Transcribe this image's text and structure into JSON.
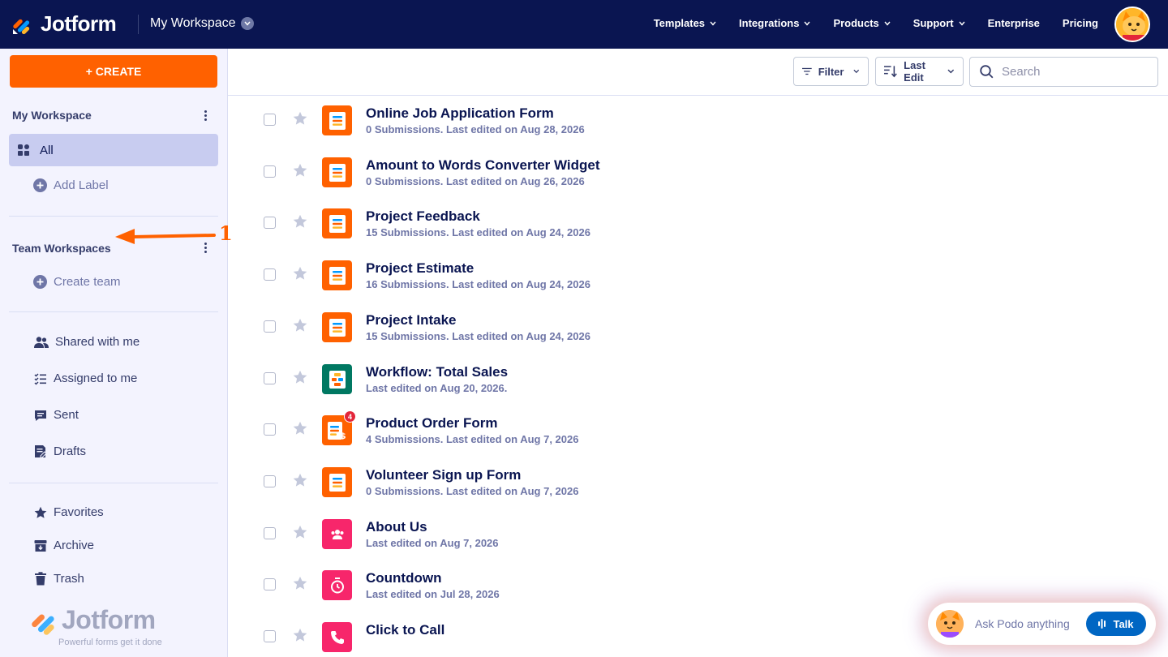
{
  "topnav": {
    "brand": "Jotform",
    "workspace_title": "My Workspace",
    "links": [
      {
        "label": "Templates",
        "has_menu": true
      },
      {
        "label": "Integrations",
        "has_menu": true
      },
      {
        "label": "Products",
        "has_menu": true
      },
      {
        "label": "Support",
        "has_menu": true
      },
      {
        "label": "Enterprise",
        "has_menu": false
      },
      {
        "label": "Pricing",
        "has_menu": false
      }
    ]
  },
  "sidebar": {
    "create_label": "+ CREATE",
    "my_workspace_title": "My Workspace",
    "all_label": "All",
    "add_label": "Add Label",
    "annotation_number": "1",
    "team_title": "Team Workspaces",
    "create_team": "Create team",
    "shared": "Shared with me",
    "assigned": "Assigned to me",
    "sent": "Sent",
    "drafts": "Drafts",
    "favorites": "Favorites",
    "archive": "Archive",
    "trash": "Trash",
    "watermark_brand": "Jotform",
    "watermark_tagline": "Powerful forms get it done"
  },
  "toolbar": {
    "filter_label": "Filter",
    "sort_label": "Last Edit",
    "search_placeholder": "Search"
  },
  "forms": [
    {
      "title": "Online Job Application Form",
      "subtitle": "0 Submissions. Last edited on Aug 28, 2026",
      "icon": "form-icon",
      "color": "#ff6100"
    },
    {
      "title": "Amount to Words Converter Widget",
      "subtitle": "0 Submissions. Last edited on Aug 26, 2026",
      "icon": "form-icon",
      "color": "#ff6100"
    },
    {
      "title": "Project Feedback",
      "subtitle": "15 Submissions. Last edited on Aug 24, 2026",
      "icon": "form-icon",
      "color": "#ff6100"
    },
    {
      "title": "Project Estimate",
      "subtitle": "16 Submissions. Last edited on Aug 24, 2026",
      "icon": "form-icon",
      "color": "#ff6100"
    },
    {
      "title": "Project Intake",
      "subtitle": "15 Submissions. Last edited on Aug 24, 2026",
      "icon": "form-icon",
      "color": "#ff6100"
    },
    {
      "title": "Workflow: Total Sales",
      "subtitle": " Last edited on Aug 20, 2026.",
      "icon": "workflow-icon",
      "color": "#007862"
    },
    {
      "title": "Product Order Form",
      "subtitle": "4 Submissions. Last edited on Aug 7, 2026",
      "icon": "payment-form-icon",
      "color": "#ff6100",
      "badge": "4"
    },
    {
      "title": "Volunteer Sign up Form",
      "subtitle": "0 Submissions. Last edited on Aug 7, 2026",
      "icon": "form-icon",
      "color": "#ff6100"
    },
    {
      "title": "About Us",
      "subtitle": "Last edited on Aug 7, 2026",
      "icon": "people-icon",
      "color": "#f7266b"
    },
    {
      "title": "Countdown",
      "subtitle": "Last edited on Jul 28, 2026",
      "icon": "timer-icon",
      "color": "#f7266b"
    },
    {
      "title": "Click to Call",
      "subtitle": "",
      "icon": "phone-icon",
      "color": "#f7266b"
    }
  ],
  "podo": {
    "prompt": "Ask Podo anything",
    "talk_label": "Talk"
  }
}
